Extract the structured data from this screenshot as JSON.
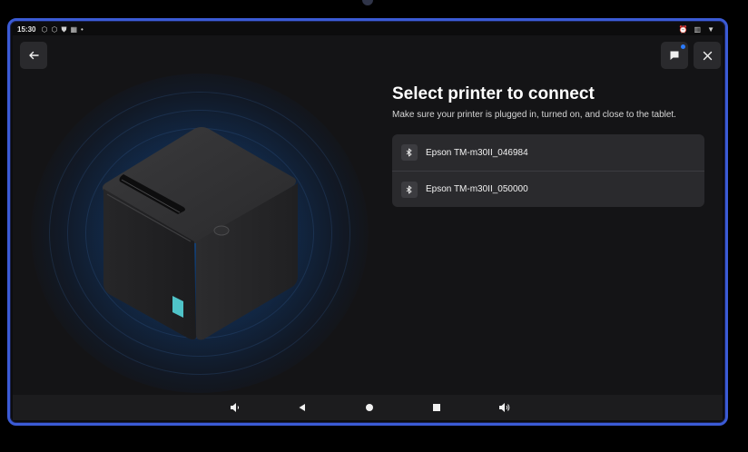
{
  "status_bar": {
    "time": "15:30",
    "left_icons": [
      "cube-icon",
      "cube-icon",
      "shield-icon",
      "calendar-icon",
      "dot-icon"
    ],
    "right_icons": [
      "alarm-icon",
      "battery-saver-icon",
      "wifi-icon"
    ]
  },
  "header": {
    "back_icon": "arrow-left-icon",
    "chat_icon": "chat-icon",
    "close_icon": "close-icon"
  },
  "main": {
    "title": "Select printer to connect",
    "subtitle": "Make sure your printer is plugged in, turned on, and close to the tablet.",
    "printers": [
      {
        "name": "Epson TM-m30II_046984",
        "icon": "bluetooth-icon"
      },
      {
        "name": "Epson TM-m30II_050000",
        "icon": "bluetooth-icon"
      }
    ]
  },
  "navbar": {
    "keys": [
      "volume-down-icon",
      "back-triangle-icon",
      "home-circle-icon",
      "recents-square-icon",
      "volume-up-icon"
    ]
  },
  "colors": {
    "frame_border": "#3b5bd6",
    "background": "#141416",
    "card": "#2a2a2d",
    "accent_dot": "#2b7bff",
    "glow": "#144b8c",
    "printer_indicator": "#4fc3c8"
  }
}
